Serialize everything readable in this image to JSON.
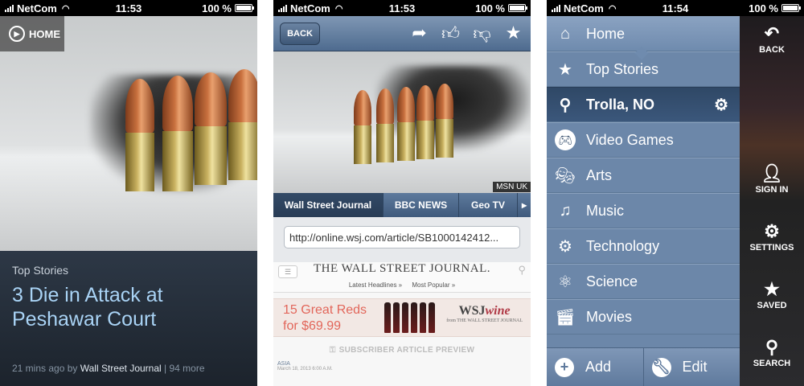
{
  "status": [
    {
      "carrier": "NetCom",
      "time": "11:53",
      "battery": "100 %"
    },
    {
      "carrier": "NetCom",
      "time": "11:53",
      "battery": "100 %"
    },
    {
      "carrier": "NetCom",
      "time": "11:54",
      "battery": "100 %"
    }
  ],
  "screen1": {
    "home_label": "HOME",
    "category": "Top Stories",
    "headline": "3 Die in Attack at Peshawar Court",
    "time_ago": "21 mins ago",
    "by": "by",
    "source": "Wall Street Journal",
    "more": "| 94 more"
  },
  "screen2": {
    "back_label": "BACK",
    "photo_credit": "MSN UK",
    "tabs": [
      "Wall Street Journal",
      "BBC NEWS",
      "Geo TV",
      "▸"
    ],
    "url": "http://online.wsj.com/article/SB1000142412...",
    "wsj_logo": "THE WALL STREET JOURNAL.",
    "wsj_links": [
      "Latest Headlines »",
      "Most Popular »"
    ],
    "ad_line1": "15 Great Reds",
    "ad_line2": "for $69.99",
    "ad_brand_a": "WSJ",
    "ad_brand_b": "wine",
    "ad_brand_sub": "from THE WALL STREET JOURNAL",
    "subscriber_label": "SUBSCRIBER ARTICLE PREVIEW",
    "article_region": "ASIA",
    "article_date": "March 18, 2013 6:00 A.M."
  },
  "screen3": {
    "menu": [
      {
        "label": "Home",
        "icon": "home-icon"
      },
      {
        "label": "Top Stories",
        "icon": "star-icon"
      },
      {
        "label": "Trolla, NO",
        "icon": "location-pin-icon"
      },
      {
        "label": "Video Games",
        "icon": "gamepad-icon"
      },
      {
        "label": "Arts",
        "icon": "theater-masks-icon"
      },
      {
        "label": "Music",
        "icon": "music-note-icon"
      },
      {
        "label": "Technology",
        "icon": "gears-icon"
      },
      {
        "label": "Science",
        "icon": "atom-icon"
      },
      {
        "label": "Movies",
        "icon": "clapperboard-icon"
      }
    ],
    "add_label": "Add",
    "edit_label": "Edit",
    "right": {
      "back": "BACK",
      "sign_in": "SIGN IN",
      "settings": "SETTINGS",
      "saved": "SAVED",
      "search": "SEARCH"
    }
  }
}
